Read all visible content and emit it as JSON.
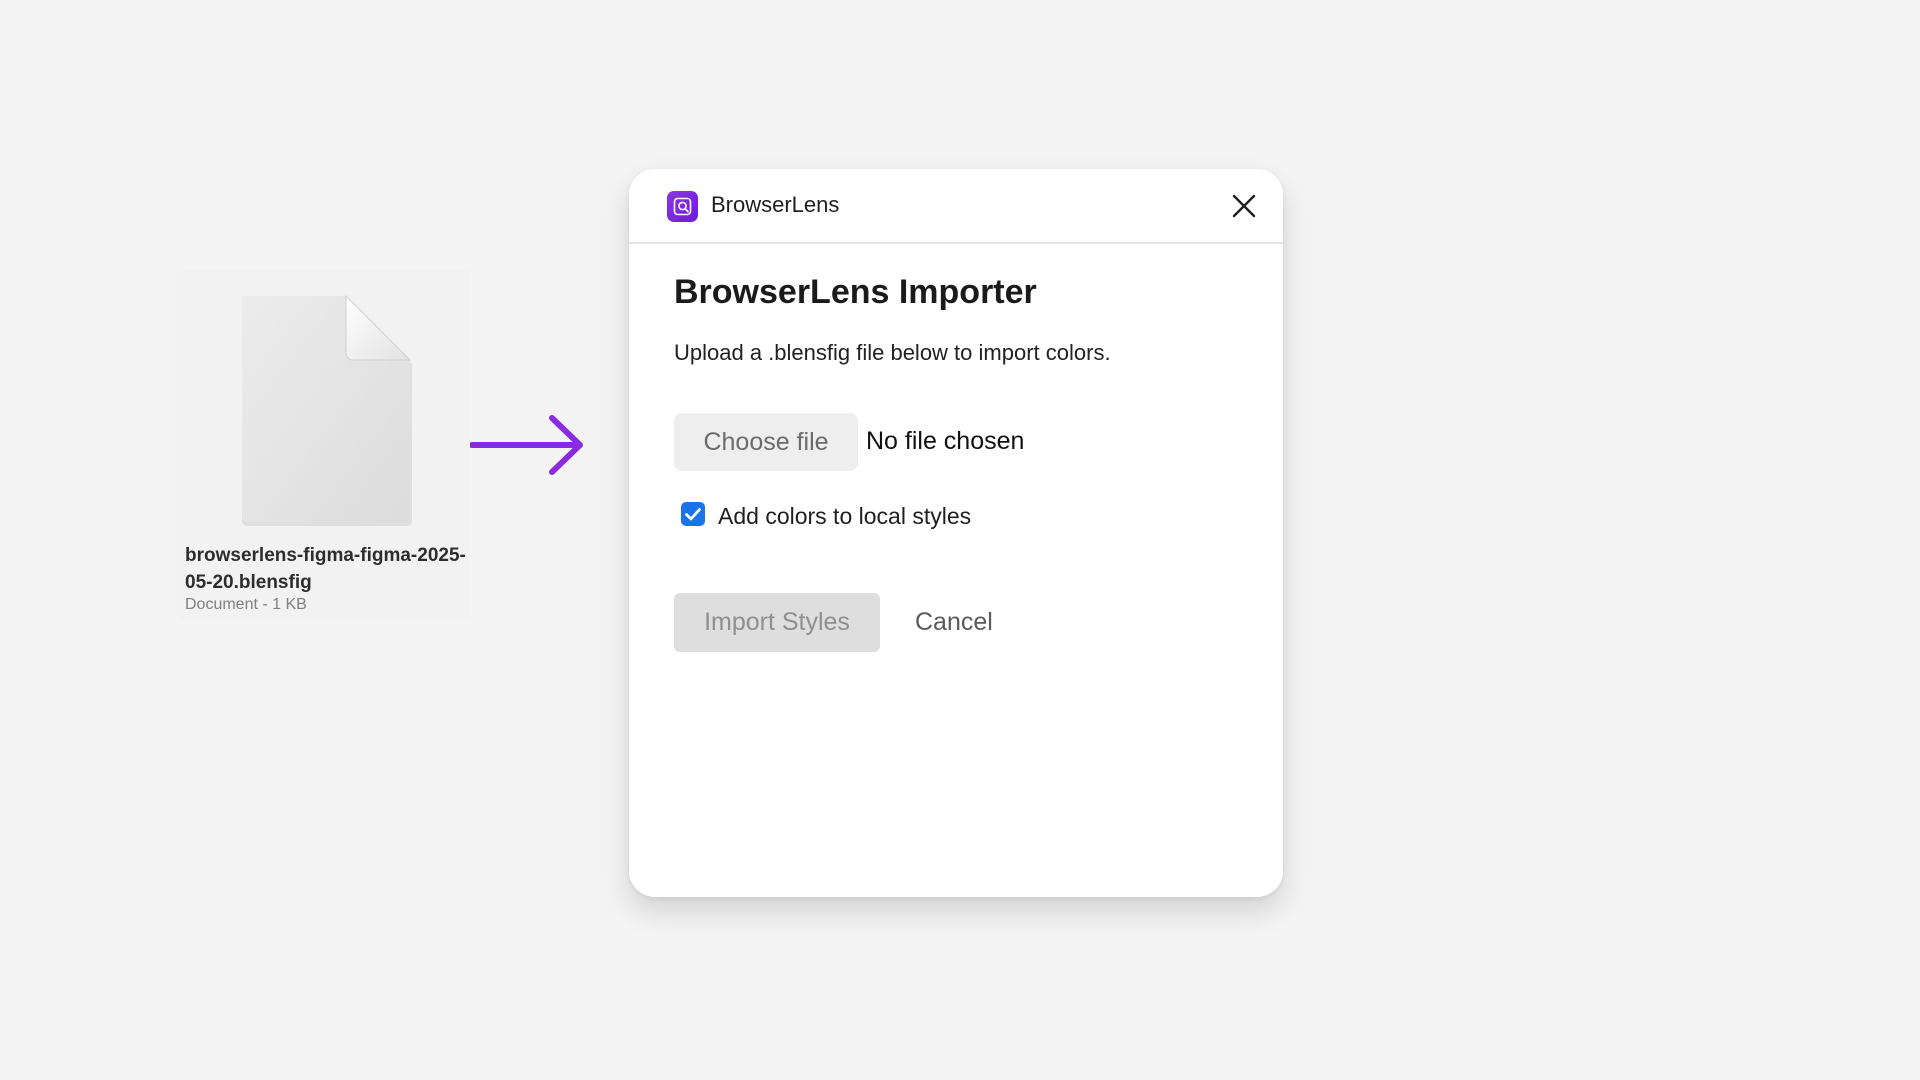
{
  "file": {
    "name": "browserlens-figma-figma-2025-05-20.blensfig",
    "meta": "Document - 1 KB",
    "icon": "document-icon"
  },
  "flow": {
    "icon": "arrow-right-icon",
    "color": "#8a2be2"
  },
  "dialog": {
    "app_name": "BrowserLens",
    "app_icon": "browserlens-logo-icon",
    "title": "BrowserLens Importer",
    "description": "Upload a .blensfig file below to import colors.",
    "file_input": {
      "button_label": "Choose file",
      "status": "No file chosen"
    },
    "option": {
      "label": "Add colors to local styles",
      "checked": true
    },
    "actions": {
      "import_label": "Import Styles",
      "import_disabled": true,
      "cancel_label": "Cancel"
    },
    "close_icon": "close-icon"
  },
  "colors": {
    "accent": "#8a2be2",
    "checkbox": "#1a73e8",
    "background": "#f4f4f4"
  }
}
